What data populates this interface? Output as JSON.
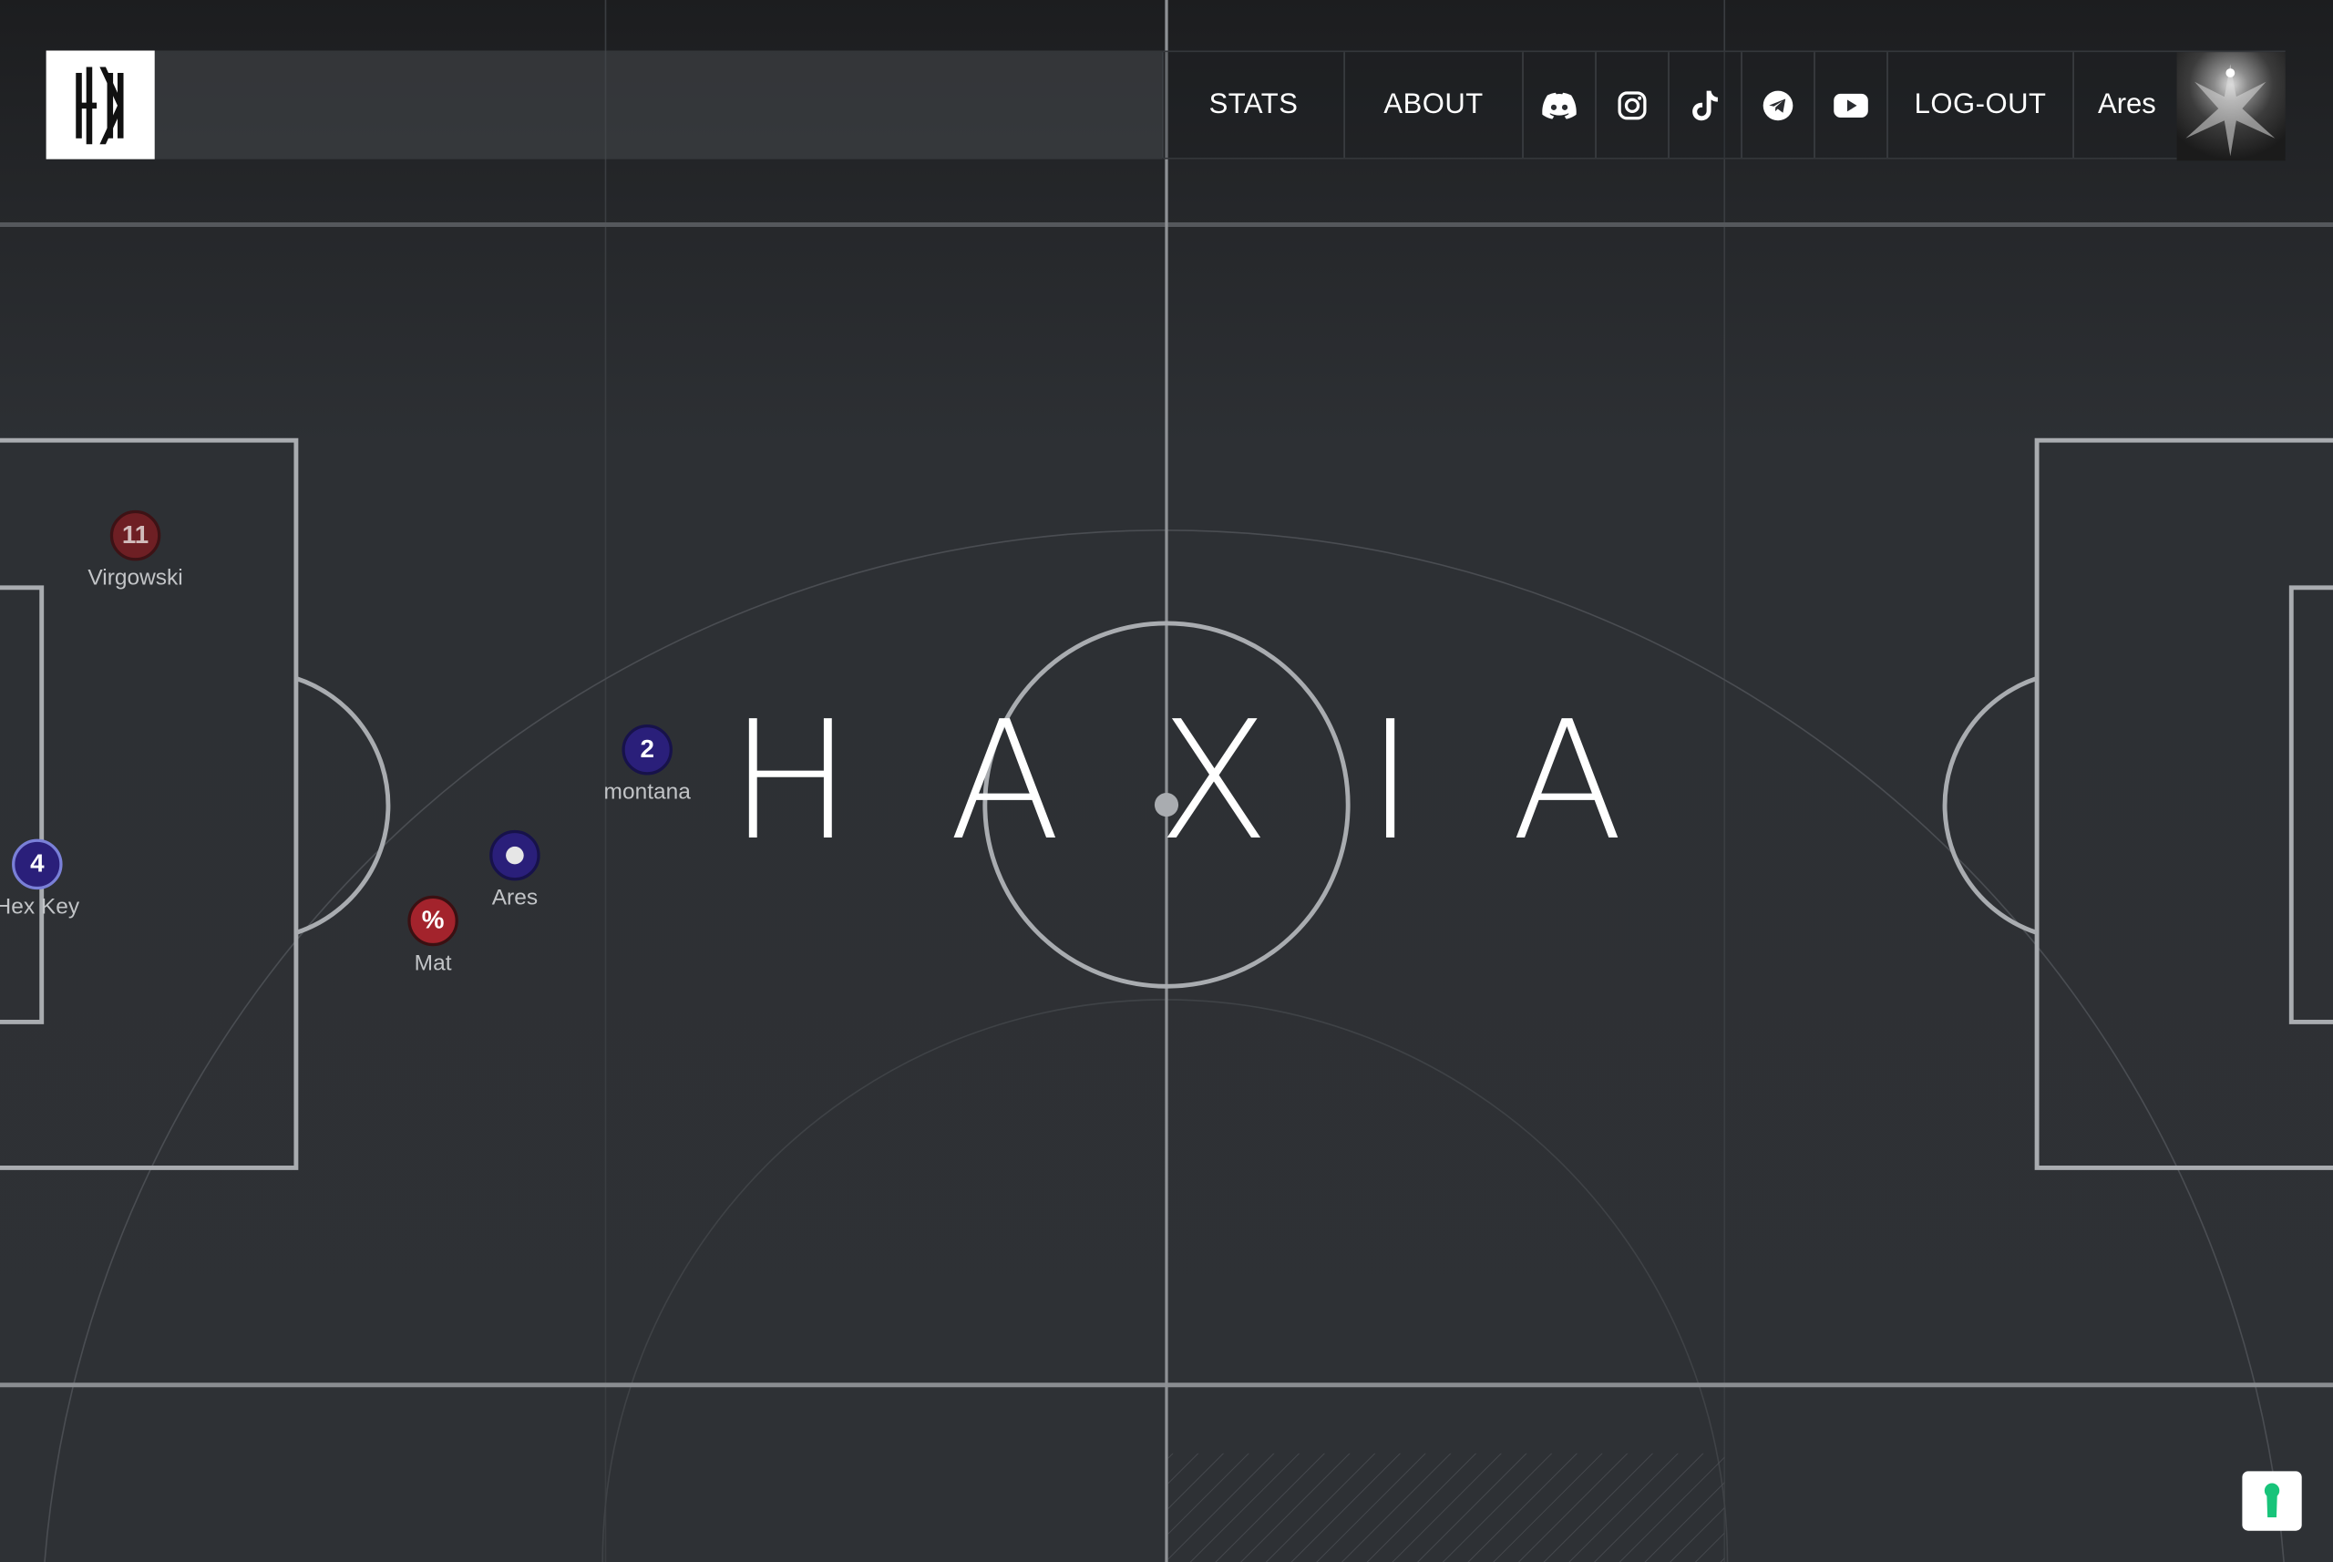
{
  "nav": {
    "stats_label": "STATS",
    "about_label": "ABOUT",
    "logout_label": "LOG-OUT",
    "user_name": "Ares",
    "social_icons": [
      "discord-icon",
      "instagram-icon",
      "tiktok-icon",
      "telegram-icon",
      "youtube-icon"
    ]
  },
  "hero": {
    "title": "HAXIA"
  },
  "players": [
    {
      "badge": "11",
      "name": "Virgowski",
      "team": "red"
    },
    {
      "badge": "4",
      "name": "Hex Key",
      "team": "blue"
    },
    {
      "badge": "2",
      "name": "montana",
      "team": "blue"
    },
    {
      "badge": "",
      "name": "Ares",
      "team": "blue"
    },
    {
      "badge": "%",
      "name": "Mat",
      "team": "red"
    }
  ],
  "colors": {
    "background": "#2e3135",
    "red_team": "#a3232c",
    "blue_team": "#2a1f7a",
    "help_accent": "#18c47a"
  }
}
